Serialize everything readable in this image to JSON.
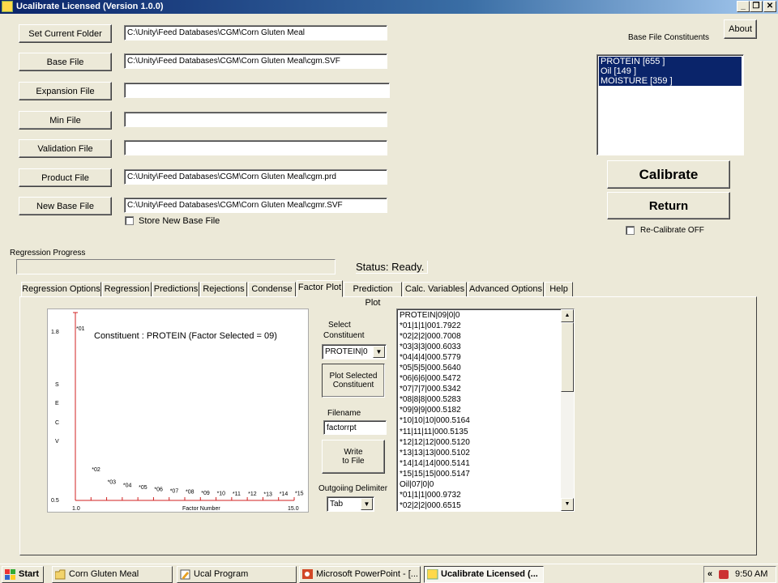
{
  "window": {
    "title": "Ucalibrate Licensed (Version 1.0.0)",
    "controls": {
      "minimize": "_",
      "restore": "❐",
      "close": "✕"
    }
  },
  "files": [
    {
      "button": "Set Current Folder",
      "value": "C:\\Unity\\Feed Databases\\CGM\\Corn Gluten Meal"
    },
    {
      "button": "Base File",
      "value": "C:\\Unity\\Feed Databases\\CGM\\Corn Gluten Meal\\cgm.SVF"
    },
    {
      "button": "Expansion File",
      "value": ""
    },
    {
      "button": "Min File",
      "value": ""
    },
    {
      "button": "Validation File",
      "value": ""
    },
    {
      "button": "Product File",
      "value": "C:\\Unity\\Feed Databases\\CGM\\Corn Gluten Meal\\cgm.prd"
    },
    {
      "button": "New Base File",
      "value": "C:\\Unity\\Feed Databases\\CGM\\Corn Gluten Meal\\cgmr.SVF"
    }
  ],
  "store_new_base_file": {
    "label": "Store New Base File",
    "checked": false
  },
  "about_button": "About",
  "constituents": {
    "label": "Base File Constituents",
    "items": [
      "PROTEIN [655 ]",
      "Oil [149 ]",
      "MOISTURE [359 ]"
    ]
  },
  "calibrate_button": "Calibrate",
  "return_button": "Return",
  "recalibrate": {
    "label": "Re-Calibrate OFF",
    "checked": false
  },
  "progress": {
    "label": "Regression Progress",
    "value": 0
  },
  "status": "Status: Ready.",
  "tabs": [
    "Regression Options",
    "Regression",
    "Predictions",
    "Rejections",
    "Condense",
    "Factor Plot",
    "Prediction Plot",
    "Calc. Variables",
    "Advanced Options",
    "Help"
  ],
  "active_tab": "Factor Plot",
  "factor_plot": {
    "select_label_1": "Select",
    "select_label_2": "Constituent",
    "selected_constituent": "PROTEIN|0",
    "plot_button_1": "Plot Selected",
    "plot_button_2": "Constituent",
    "filename_label": "Filename",
    "filename": "factorrpt",
    "write_button_1": "Write",
    "write_button_2": "to File",
    "delimiter_label": "Outgoiing Delimiter",
    "delimiter": "Tab",
    "list": [
      "PROTEIN|09|0|0",
      "*01|1|1|001.7922",
      "*02|2|2|000.7008",
      "*03|3|3|000.6033",
      "*04|4|4|000.5779",
      "*05|5|5|000.5640",
      "*06|6|6|000.5472",
      "*07|7|7|000.5342",
      "*08|8|8|000.5283",
      "*09|9|9|000.5182",
      "*10|10|10|000.5164",
      "*11|11|11|000.5135",
      "*12|12|12|000.5120",
      "*13|13|13|000.5102",
      "*14|14|14|000.5141",
      "*15|15|15|000.5147",
      "Oil|07|0|0",
      "*01|1|1|000.9732",
      "*02|2|2|000.6515"
    ]
  },
  "chart_data": {
    "type": "scatter",
    "title": "Constituent : PROTEIN (Factor Selected = 09)",
    "xlabel": "Factor Number",
    "ylabel": "SECV",
    "x_ticks": [
      "1.0",
      "15.0"
    ],
    "y_ticks": [
      "1.8",
      "0.5"
    ],
    "xlim": [
      1,
      15
    ],
    "ylim": [
      0.5,
      1.8
    ],
    "x": [
      1,
      2,
      3,
      4,
      5,
      6,
      7,
      8,
      9,
      10,
      11,
      12,
      13,
      14,
      15
    ],
    "y": [
      1.7922,
      0.7008,
      0.6033,
      0.5779,
      0.564,
      0.5472,
      0.5342,
      0.5283,
      0.5182,
      0.5164,
      0.5135,
      0.512,
      0.5102,
      0.5141,
      0.5147
    ],
    "point_labels": [
      "01",
      "02",
      "03",
      "04",
      "05",
      "06",
      "07",
      "08",
      "09",
      "10",
      "11",
      "12",
      "13",
      "14",
      "15"
    ],
    "axis_color": "#d02020"
  },
  "taskbar": {
    "start": "Start",
    "items": [
      {
        "label": "Corn Gluten Meal",
        "icon": "folder-icon"
      },
      {
        "label": "Ucal Program",
        "icon": "pencil-icon"
      },
      {
        "label": "Microsoft PowerPoint - [...",
        "icon": "powerpoint-icon"
      },
      {
        "label": "Ucalibrate Licensed (...",
        "icon": "app-icon"
      }
    ],
    "tray_chevron": "«",
    "clock": "9:50 AM"
  }
}
